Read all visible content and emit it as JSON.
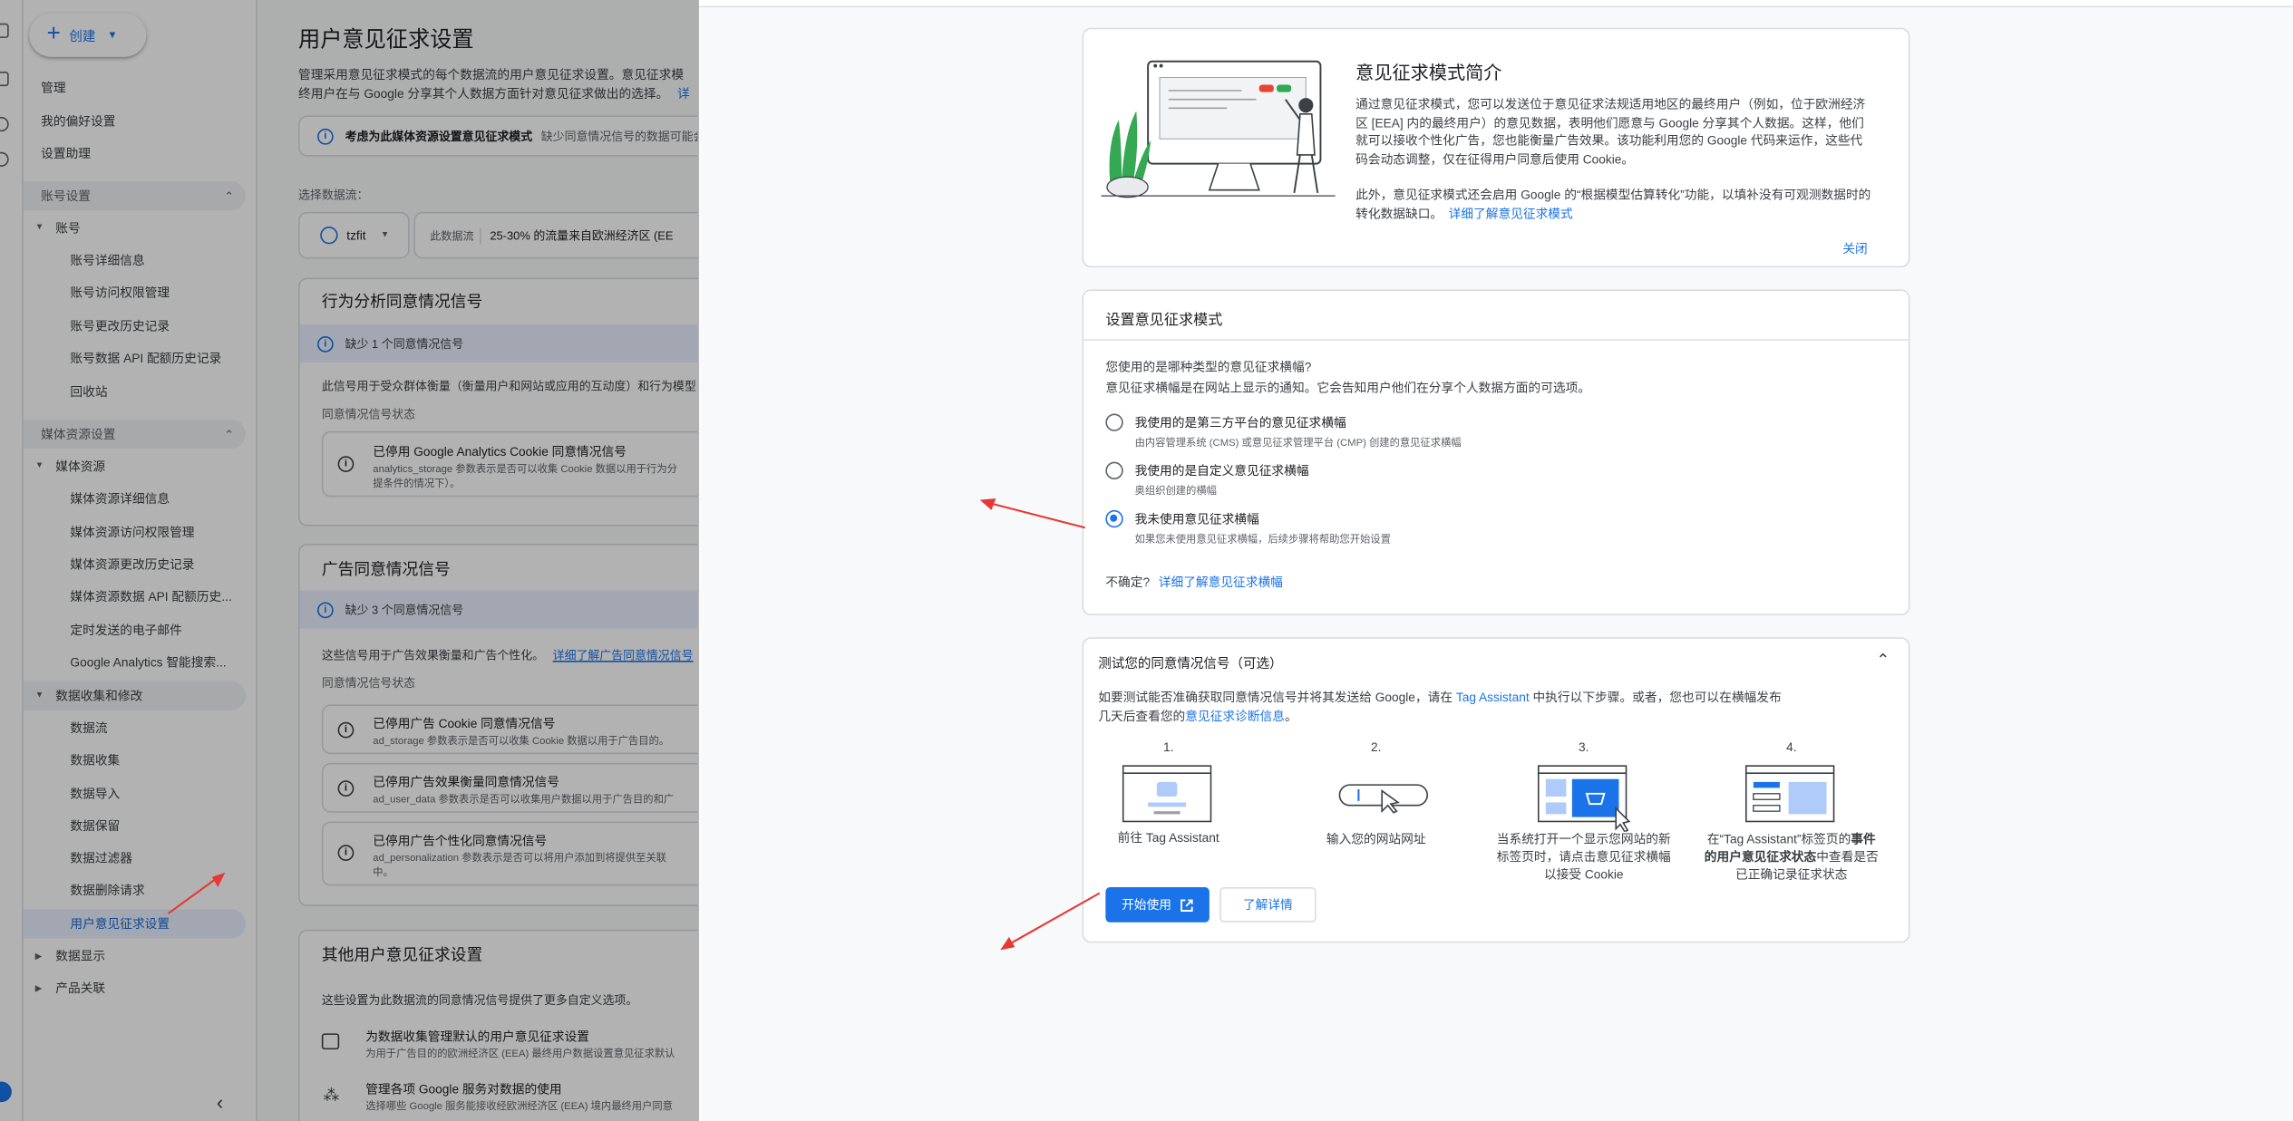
{
  "sidebar": {
    "create_label": "创建",
    "items": [
      {
        "label": "管理"
      },
      {
        "label": "我的偏好设置"
      },
      {
        "label": "设置助理"
      },
      {
        "label": "账号设置"
      },
      {
        "label": "账号"
      },
      {
        "label": "账号详细信息"
      },
      {
        "label": "账号访问权限管理"
      },
      {
        "label": "账号更改历史记录"
      },
      {
        "label": "账号数据 API 配额历史记录"
      },
      {
        "label": "回收站"
      },
      {
        "label": "媒体资源设置"
      },
      {
        "label": "媒体资源"
      },
      {
        "label": "媒体资源详细信息"
      },
      {
        "label": "媒体资源访问权限管理"
      },
      {
        "label": "媒体资源更改历史记录"
      },
      {
        "label": "媒体资源数据 API 配额历史..."
      },
      {
        "label": "定时发送的电子邮件"
      },
      {
        "label": "Google Analytics 智能搜索..."
      },
      {
        "label": "数据收集和修改"
      },
      {
        "label": "数据流"
      },
      {
        "label": "数据收集"
      },
      {
        "label": "数据导入"
      },
      {
        "label": "数据保留"
      },
      {
        "label": "数据过滤器"
      },
      {
        "label": "数据删除请求"
      },
      {
        "label": "用户意见征求设置"
      },
      {
        "label": "数据显示"
      },
      {
        "label": "产品关联"
      }
    ]
  },
  "main": {
    "title": "用户意见征求设置",
    "desc1": "管理采用意见征求模式的每个数据流的用户意见征求设置。意见征求模",
    "desc2": "终用户在与 Google 分享其个人数据方面针对意见征求做出的选择。",
    "desc_link": "详",
    "banner_bold": "考虑为此媒体资源设置意见征求模式",
    "banner_rest": "缺少同意情况信号的数据可能会",
    "stream_label": "选择数据流：",
    "stream_value": "tzfit",
    "stream_info_prefix": "此数据流",
    "stream_info": "25-30% 的流量来自欧洲经济区 (EE",
    "behavior_title": "行为分析同意情况信号",
    "behavior_missing": "缺少 1 个同意情况信号",
    "behavior_desc": "此信号用于受众群体衡量（衡量用户和网站或应用的互动度）和行为模型",
    "signal_status": "同意情况信号状态",
    "behavior_item_title": "已停用 Google Analytics Cookie 同意情况信号",
    "behavior_item_sub1": "analytics_storage 参数表示是否可以收集 Cookie 数据以用于行为分",
    "behavior_item_sub2": "提条件的情况下）。",
    "ads_title": "广告同意情况信号",
    "ads_missing": "缺少 3 个同意情况信号",
    "ads_desc": "这些信号用于广告效果衡量和广告个性化。",
    "ads_desc_link": "详细了解广告同意情况信号",
    "ads_items": [
      {
        "title": "已停用广告 Cookie 同意情况信号",
        "sub": "ad_storage 参数表示是否可以收集 Cookie 数据以用于广告目的。"
      },
      {
        "title": "已停用广告效果衡量同意情况信号",
        "sub": "ad_user_data 参数表示是否可以收集用户数据以用于广告目的和广"
      },
      {
        "title": "已停用广告个性化同意情况信号",
        "sub": "ad_personalization 参数表示是否可以将用户添加到将提供至关联",
        "sub2": "中。"
      }
    ],
    "other_title": "其他用户意见征求设置",
    "other_desc": "这些设置为此数据流的同意情况信号提供了更多自定义选项。",
    "other_items": [
      {
        "title": "为数据收集管理默认的用户意见征求设置",
        "sub": "为用于广告目的的欧洲经济区 (EEA) 最终用户数据设置意见征求默认"
      },
      {
        "title": "管理各项 Google 服务对数据的使用",
        "sub": "选择哪些 Google 服务能接收经欧洲经济区 (EEA) 境内最终用户同意"
      }
    ]
  },
  "intro": {
    "title": "意见征求模式简介",
    "p1": [
      "通过意见征求模式，您可以发送位于意见征求法规适用地区的最终用户（例如，位于欧洲经济",
      "区 [EEA] 内的最终用户）的意见数据，表明他们愿意与 Google 分享其个人数据。这样，他们",
      "就可以接收个性化广告，您也能衡量广告效果。该功能利用您的 Google 代码来运作，这些代",
      "码会动态调整，仅在征得用户同意后使用 Cookie。"
    ],
    "p2": [
      "此外，意见征求模式还会启用 Google 的“根据模型估算转化”功能，以填补没有可观测数据时的",
      "转化数据缺口。"
    ],
    "p2_link": "详细了解意见征求模式",
    "close": "关闭"
  },
  "setup": {
    "title": "设置意见征求模式",
    "q1": "您使用的是哪种类型的意见征求横幅?",
    "q2": "意见征求横幅是在网站上显示的通知。它会告知用户他们在分享个人数据方面的可选项。",
    "options": [
      {
        "label": "我使用的是第三方平台的意见征求横幅",
        "sub": "由内容管理系统 (CMS) 或意见征求管理平台 (CMP) 创建的意见征求横幅",
        "selected": false
      },
      {
        "label": "我使用的是自定义意见征求横幅",
        "sub": "奥组织创建的横幅",
        "selected": false
      },
      {
        "label": "我未使用意见征求横幅",
        "sub": "如果您未使用意见征求横幅，后续步骤将帮助您开始设置",
        "selected": true
      }
    ],
    "unsure": "不确定?",
    "unsure_link": "详细了解意见征求横幅"
  },
  "test": {
    "title": "测试您的同意情况信号（可选）",
    "desc1_a": "如要测试能否准确获取同意情况信号并将其发送给 Google，请在 ",
    "desc1_link": "Tag Assistant",
    "desc1_b": " 中执行以下步骤。或者，您也可以在横幅发布",
    "desc2_a": "几天后查看您的",
    "desc2_link": "意见征求诊断信息",
    "desc2_b": "。",
    "steps": [
      {
        "num": "1.",
        "lines": [
          "前往 Tag Assistant"
        ]
      },
      {
        "num": "2.",
        "lines": [
          "输入您的网站网址"
        ]
      },
      {
        "num": "3.",
        "lines": [
          "当系统打开一个显示您网站的新",
          "标签页时，请点击意见征求横幅",
          "以接受 Cookie"
        ]
      },
      {
        "num": "4.",
        "lines_rich": true,
        "l1a": "在“Tag Assistant”标签页的",
        "l1b": "事件",
        "l2a": "的用户意见征求状态",
        "l2b": "中查看是否",
        "l3": "已正确记录征求状态"
      }
    ],
    "start": "开始使用",
    "learn": "了解详情"
  },
  "colors": {
    "accent": "#1a73e8",
    "arrow": "#e53935",
    "selected_nav": "#e8f0fe"
  }
}
